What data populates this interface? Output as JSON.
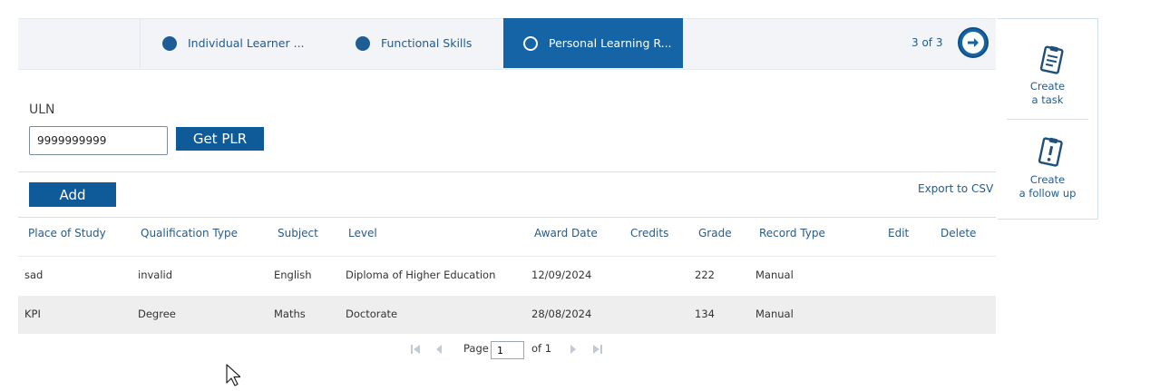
{
  "wizard": {
    "tabs": [
      {
        "label": "Individual Learner ...",
        "state": "complete"
      },
      {
        "label": "Functional Skills",
        "state": "complete"
      },
      {
        "label": "Personal Learning R...",
        "state": "active"
      }
    ],
    "step_counter": "3 of 3",
    "next_icon": "arrow-right-circle-icon"
  },
  "side_panel": {
    "create_task": {
      "line1": "Create",
      "line2": "a task",
      "icon": "clipboard-list-icon"
    },
    "create_follow_up": {
      "line1": "Create",
      "line2": "a follow up",
      "icon": "clipboard-alert-icon"
    }
  },
  "form": {
    "uln_label": "ULN",
    "uln_value": "9999999999",
    "get_plr_label": "Get PLR",
    "add_label": "Add",
    "export_label": "Export to CSV"
  },
  "table": {
    "headers": [
      "Place of Study",
      "Qualification Type",
      "Subject",
      "Level",
      "Award Date",
      "Credits",
      "Grade",
      "Record Type",
      "Edit",
      "Delete"
    ],
    "rows": [
      {
        "place": "sad",
        "qualification": "invalid",
        "subject": "English",
        "level": "Diploma of Higher Education",
        "award_date": "12/09/2024",
        "credits": "",
        "grade": "222",
        "record_type": "Manual"
      },
      {
        "place": "KPI",
        "qualification": "Degree",
        "subject": "Maths",
        "level": "Doctorate",
        "award_date": "28/08/2024",
        "credits": "",
        "grade": "134",
        "record_type": "Manual"
      }
    ]
  },
  "pager": {
    "page_label": "Page",
    "page_value": "1",
    "of_label": "of 1"
  },
  "colors": {
    "primary": "#1565a6",
    "button": "#0f5a99",
    "link": "#1f5c93",
    "alt_row": "#eeeeee"
  }
}
